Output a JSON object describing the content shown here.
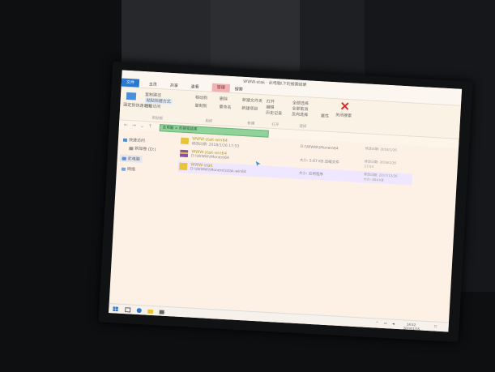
{
  "window": {
    "title": "WWW-stak · 此电脑\\下的搜索结果"
  },
  "tabs": [
    {
      "label": "文件"
    },
    {
      "label": "主页"
    },
    {
      "label": "共享"
    },
    {
      "label": "查看"
    },
    {
      "label": "搜索"
    },
    {
      "label": "管理"
    }
  ],
  "ribbon": {
    "pin_label": "固定到快速访问",
    "copy_path_label": "复制路径",
    "paste_shortcut_label": "粘贴快捷方式",
    "move_to_label": "移动到",
    "copy_to_label": "复制到",
    "delete_label": "删除",
    "rename_label": "重命名",
    "new_folder_label": "新建文件夹",
    "new_item_label": "新建项目",
    "easy_access_label": "轻松访问",
    "open_label": "打开",
    "edit_label": "编辑",
    "history_label": "历史记录",
    "select_all_label": "全部选择",
    "select_none_label": "全部取消",
    "invert_label": "反向选择",
    "properties_label": "属性",
    "close_search_label": "关闭搜索",
    "group_clipboard": "剪贴板",
    "group_organize": "组织",
    "group_new": "新建",
    "group_open": "打开",
    "group_select": "选择"
  },
  "address": {
    "value": "此电脑 > 的搜索结果"
  },
  "sidebar": {
    "items": [
      {
        "label": "快速访问"
      },
      {
        "label": "新加卷 (D:)"
      },
      {
        "label": "此电脑"
      },
      {
        "label": "网络"
      }
    ]
  },
  "files": [
    {
      "name": "WWW-stak-win64",
      "path": "修改日期: 2018/1/26 17:53",
      "mid": "D:\\\\WWW\\\\Monero64",
      "date": "修改日期: 2018/1/26",
      "size": ""
    },
    {
      "name": "WWW-stak-win64",
      "path": "D:\\\\WWW\\\\Monero64",
      "mid": "大小: 5.67 KB 压缩文件",
      "date": "修改日期: 2018/1/26",
      "size": "17:53"
    },
    {
      "name": "WWW-stak",
      "path": "D:\\\\WWW\\\\Monero\\\\stak-win64",
      "mid": "大小: 应用程序",
      "date": "修改日期: 2017/12/26",
      "size": "大小: 404 KB"
    }
  ],
  "taskbar": {
    "time": "14:52",
    "date": "2018/1/26"
  },
  "colors": {
    "file_tab": "#2a78d0",
    "manage_tab": "#f0b2b2",
    "address_highlight": "#8fd39b",
    "delete_red": "#d23030",
    "folder_yellow": "#e8c43a"
  }
}
